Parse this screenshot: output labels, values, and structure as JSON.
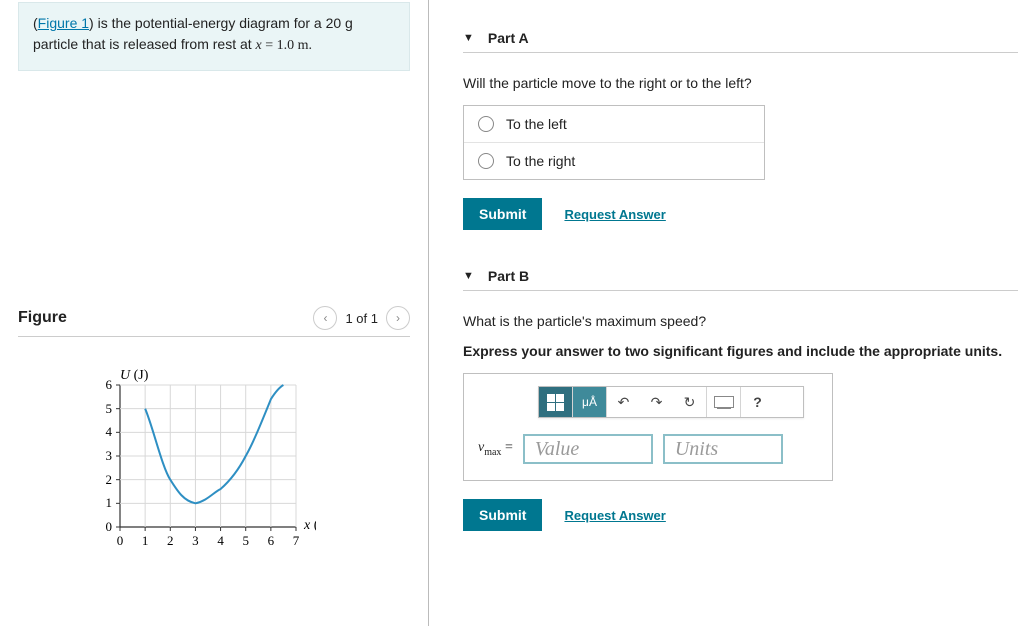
{
  "problem": {
    "figure_link_text": "Figure 1",
    "statement_before": "(",
    "statement_after_link": ") is the potential-energy diagram for a 20 g particle that is released from rest at ",
    "var1": "x",
    "eq": " = 1.0 m."
  },
  "figure": {
    "title": "Figure",
    "pager": "1 of 1"
  },
  "chart_data": {
    "type": "line",
    "title": "",
    "xlabel": "x (m)",
    "ylabel": "U (J)",
    "xlim": [
      0,
      7
    ],
    "ylim": [
      0,
      6
    ],
    "x_ticks": [
      0,
      1,
      2,
      3,
      4,
      5,
      6,
      7
    ],
    "y_ticks": [
      0,
      1,
      2,
      3,
      4,
      5,
      6
    ],
    "series": [
      {
        "name": "U(x)",
        "x": [
          1.0,
          1.5,
          2.0,
          2.5,
          3.0,
          3.5,
          4.0,
          5.0,
          5.5,
          6.0,
          6.5
        ],
        "values": [
          5.0,
          3.4,
          2.0,
          1.2,
          1.0,
          1.2,
          1.6,
          3.0,
          4.0,
          5.4,
          6.0
        ]
      }
    ]
  },
  "partA": {
    "heading": "Part A",
    "question": "Will the particle move to the right or to the left?",
    "options": [
      "To the left",
      "To the right"
    ],
    "submit": "Submit",
    "request": "Request Answer"
  },
  "partB": {
    "heading": "Part B",
    "question": "What is the particle's maximum speed?",
    "instruction": "Express your answer to two significant figures and include the appropriate units.",
    "toolbar": {
      "mu_a": "μÅ",
      "help": "?"
    },
    "label_var": "v",
    "label_sub": "max",
    "label_eq": " =",
    "value_placeholder": "Value",
    "units_placeholder": "Units",
    "submit": "Submit",
    "request": "Request Answer"
  }
}
